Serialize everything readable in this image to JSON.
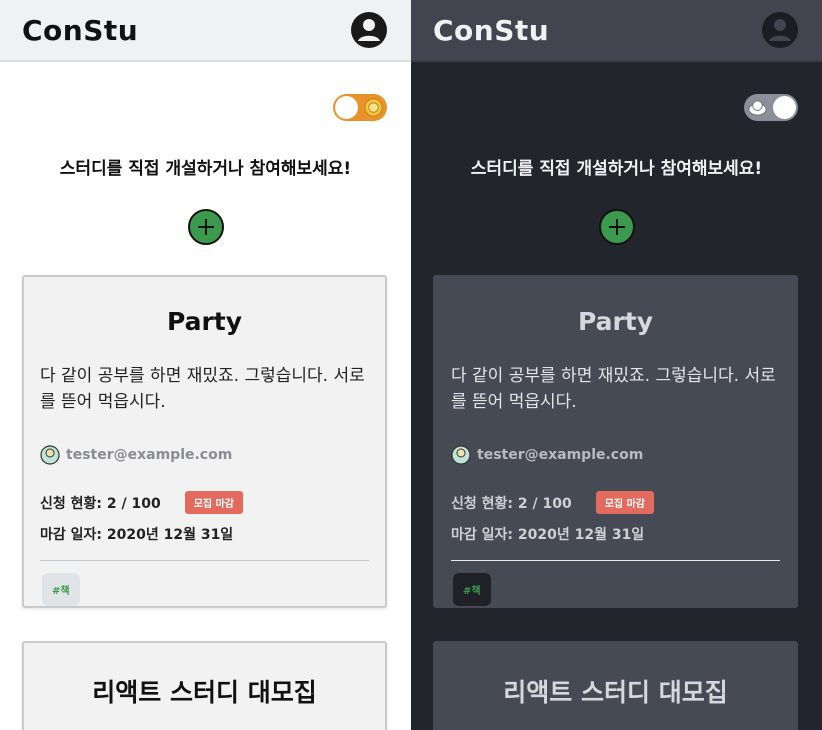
{
  "app": {
    "logo": "ConStu"
  },
  "hero": {
    "cta": "스터디를 직접 개설하거나 참여해보세요!"
  },
  "studies": [
    {
      "title": "Party",
      "description": "다 같이 공부를 하면 재밌죠. 그렇습니다. 서로를 뜯어 먹읍시다.",
      "author": "tester@example.com",
      "applicants": "신청 현황: 2 / 100",
      "badge": "모집 마감",
      "deadline": "마감 일자: 2020년 12월 31일",
      "tag": "#책"
    },
    {
      "title": "리액트 스터디 대모집"
    }
  ],
  "colors": {
    "accent_green": "#3c9a4f",
    "badge_red": "#e26b5e",
    "toggle_light": "#e9922a",
    "dark_bg": "#23252c",
    "dark_card": "#464a55"
  },
  "icons": {
    "profile": "user-circle-icon",
    "theme_light": "sun-icon",
    "theme_dark": "moon-cloud-icon",
    "add": "plus-circle-icon",
    "author": "avatar-icon"
  }
}
